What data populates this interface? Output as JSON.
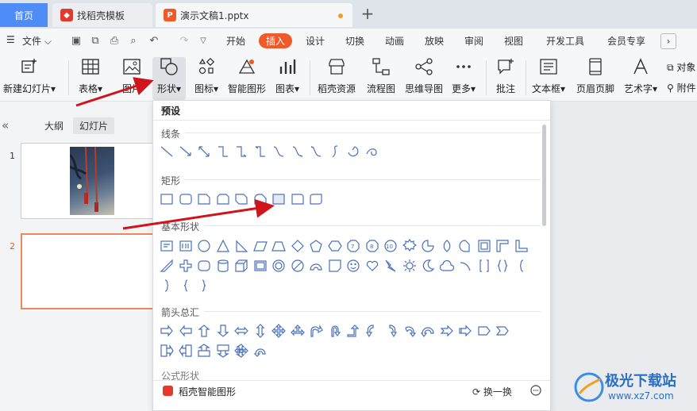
{
  "tabs": {
    "home": "首页",
    "template": "找稻壳模板",
    "document": "演示文稿1.pptx"
  },
  "menu": {
    "file": "文件",
    "items": [
      "开始",
      "插入",
      "设计",
      "切换",
      "动画",
      "放映",
      "审阅",
      "视图",
      "开发工具",
      "会员专享"
    ],
    "active": "插入"
  },
  "ribbon": {
    "new_slide": "新建幻灯片",
    "table": "表格",
    "picture": "图片",
    "shape": "形状",
    "icon": "图标",
    "smart_graphic": "智能图形",
    "chart": "图表",
    "daoke_res": "稻壳资源",
    "flowchart": "流程图",
    "mindmap": "思维导图",
    "more": "更多",
    "comment": "批注",
    "textbox": "文本框",
    "header_footer": "页眉页脚",
    "art_text": "艺术字",
    "object": "对象",
    "attach": "附件"
  },
  "panel": {
    "outline": "大纲",
    "slides": "幻灯片",
    "slide1": "1",
    "slide2": "2"
  },
  "dropdown": {
    "preset": "预设",
    "lines": "线条",
    "rect": "矩形",
    "basic": "基本形状",
    "arrows": "箭头总汇",
    "formula": "公式形状",
    "smart": "稻壳智能图形",
    "swap": "换一换"
  },
  "watermark": {
    "name": "极光下载站",
    "url": "www.xz7.com"
  }
}
